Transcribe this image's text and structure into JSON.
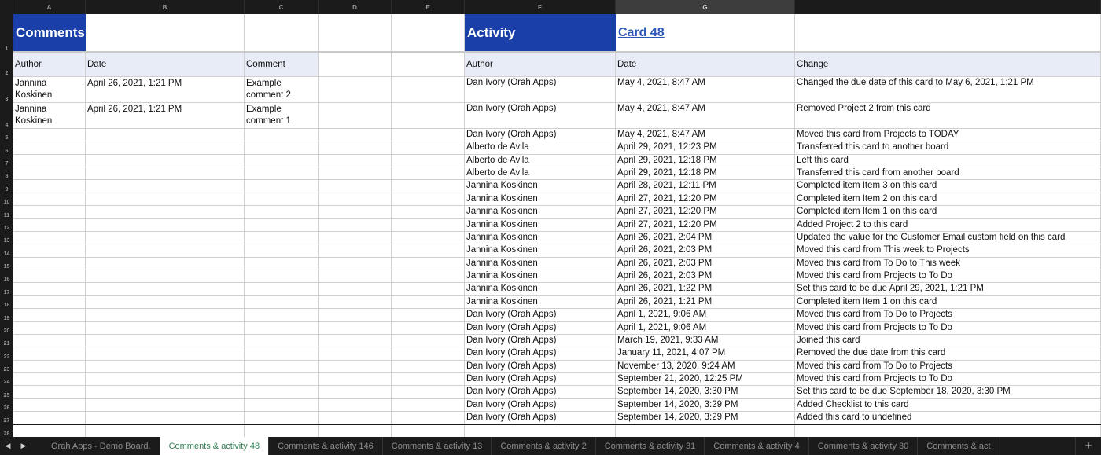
{
  "columns": [
    "A",
    "B",
    "C",
    "D",
    "E",
    "F",
    "G"
  ],
  "selected_column": "G",
  "comments": {
    "title": "Comments",
    "headers": [
      "Author",
      "Date",
      "Comment"
    ],
    "rows": [
      [
        "Jannina Koskinen",
        "April 26, 2021, 1:21 PM",
        "Example comment 2"
      ],
      [
        "Jannina Koskinen",
        "April 26, 2021, 1:21 PM",
        "Example comment 1"
      ]
    ]
  },
  "activity": {
    "title": "Activity",
    "card_link": "Card 48",
    "headers": [
      "Author",
      "Date",
      "Change"
    ],
    "rows": [
      [
        "Dan Ivory (Orah Apps)",
        "May 4, 2021, 8:47 AM",
        "Changed the due date of this card to May 6, 2021, 1:21 PM"
      ],
      [
        "Dan Ivory (Orah Apps)",
        "May 4, 2021, 8:47 AM",
        "Removed Project 2 from this card"
      ],
      [
        "Dan Ivory (Orah Apps)",
        "May 4, 2021, 8:47 AM",
        "Moved this card from Projects to TODAY"
      ],
      [
        "Alberto de Avila",
        "April 29, 2021, 12:23 PM",
        "Transferred this card to another board"
      ],
      [
        "Alberto de Avila",
        "April 29, 2021, 12:18 PM",
        "Left this card"
      ],
      [
        "Alberto de Avila",
        "April 29, 2021, 12:18 PM",
        "Transferred this card from another board"
      ],
      [
        "Jannina Koskinen",
        "April 28, 2021, 12:11 PM",
        "Completed item Item 3 on this card"
      ],
      [
        "Jannina Koskinen",
        "April 27, 2021, 12:20 PM",
        "Completed item Item 2 on this card"
      ],
      [
        "Jannina Koskinen",
        "April 27, 2021, 12:20 PM",
        "Completed item Item 1 on this card"
      ],
      [
        "Jannina Koskinen",
        "April 27, 2021, 12:20 PM",
        "Added Project 2 to this card"
      ],
      [
        "Jannina Koskinen",
        "April 26, 2021, 2:04 PM",
        "Updated the value for the Customer Email custom field on this card"
      ],
      [
        "Jannina Koskinen",
        "April 26, 2021, 2:03 PM",
        "Moved this card from This week to Projects"
      ],
      [
        "Jannina Koskinen",
        "April 26, 2021, 2:03 PM",
        "Moved this card from To Do to This week"
      ],
      [
        "Jannina Koskinen",
        "April 26, 2021, 2:03 PM",
        "Moved this card from Projects to To Do"
      ],
      [
        "Jannina Koskinen",
        "April 26, 2021, 1:22 PM",
        "Set this card to be due April 29, 2021, 1:21 PM"
      ],
      [
        "Jannina Koskinen",
        "April 26, 2021, 1:21 PM",
        "Completed item Item 1 on this card"
      ],
      [
        "Dan Ivory (Orah Apps)",
        "April 1, 2021, 9:06 AM",
        "Moved this card from To Do to Projects"
      ],
      [
        "Dan Ivory (Orah Apps)",
        "April 1, 2021, 9:06 AM",
        "Moved this card from Projects to To Do"
      ],
      [
        "Dan Ivory (Orah Apps)",
        "March 19, 2021, 9:33 AM",
        "Joined this card"
      ],
      [
        "Dan Ivory (Orah Apps)",
        "January 11, 2021, 4:07 PM",
        "Removed the due date from this card"
      ],
      [
        "Dan Ivory (Orah Apps)",
        "November 13, 2020, 9:24 AM",
        "Moved this card from To Do to Projects"
      ],
      [
        "Dan Ivory (Orah Apps)",
        "September 21, 2020, 12:25 PM",
        "Moved this card from Projects to To Do"
      ],
      [
        "Dan Ivory (Orah Apps)",
        "September 14, 2020, 3:30 PM",
        "Set this card to be due September 18, 2020, 3:30 PM"
      ],
      [
        "Dan Ivory (Orah Apps)",
        "September 14, 2020, 3:29 PM",
        "Added Checklist to this card"
      ],
      [
        "Dan Ivory (Orah Apps)",
        "September 14, 2020, 3:29 PM",
        "Added this card to undefined"
      ]
    ]
  },
  "tabs": [
    {
      "label": "Orah Apps - Demo Board.",
      "active": false
    },
    {
      "label": "Comments & activity 48",
      "active": true
    },
    {
      "label": "Comments & activity 146",
      "active": false
    },
    {
      "label": "Comments & activity 13",
      "active": false
    },
    {
      "label": "Comments & activity 2",
      "active": false
    },
    {
      "label": "Comments & activity 31",
      "active": false
    },
    {
      "label": "Comments & activity 4",
      "active": false
    },
    {
      "label": "Comments & activity 30",
      "active": false
    },
    {
      "label": "Comments & act",
      "active": false
    }
  ],
  "tabbar": {
    "prev_icon": "◀",
    "next_icon": "▶",
    "add_icon": "+"
  },
  "colors": {
    "title_bg": "#1a3fa8",
    "header_bg": "#e8ecf6",
    "link": "#2a56b8",
    "active_tab_text": "#2e7d4f"
  }
}
